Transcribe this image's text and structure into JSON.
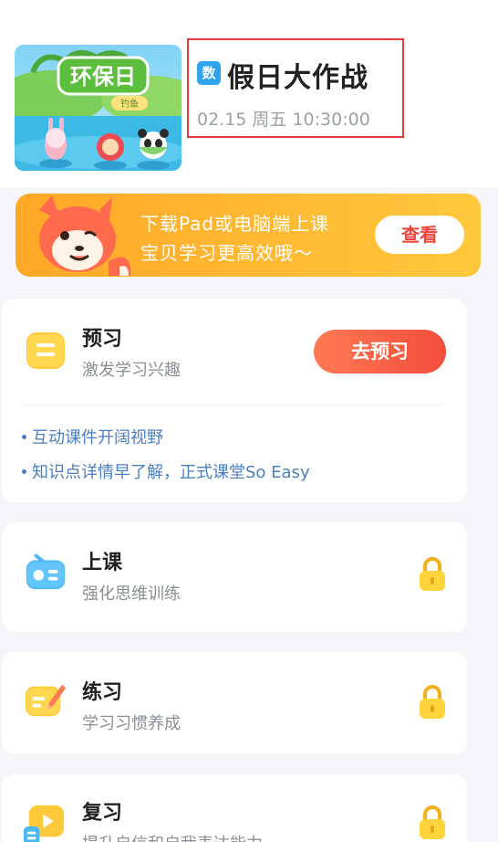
{
  "lesson": {
    "cover_title": "环保日",
    "cover_badge": "钓鱼",
    "subject_badge": "数",
    "title": "假日大作战",
    "time": "02.15 周五 10:30:00"
  },
  "banner": {
    "line1": "下载Pad或电脑端上课",
    "line2": "宝贝学习更高效哦～",
    "button_label": "查看"
  },
  "sections": {
    "preview": {
      "title": "预习",
      "subtitle": "激发学习兴趣",
      "button_label": "去预习",
      "bullets": [
        "互动课件开阔视野",
        "知识点详情早了解，正式课堂So Easy"
      ]
    },
    "class": {
      "title": "上课",
      "subtitle": "强化思维训练",
      "locked": true
    },
    "practice": {
      "title": "练习",
      "subtitle": "学习习惯养成",
      "locked": true
    },
    "review": {
      "title": "复习",
      "subtitle": "提升自信和自我表达能力",
      "locked": true
    }
  },
  "colors": {
    "accent_red": "#f24d3c",
    "banner_orange": "#ffb933",
    "bullet_blue": "#4b7fbf",
    "lock_yellow": "#ffc93c",
    "highlight_border": "#e03a3a"
  }
}
